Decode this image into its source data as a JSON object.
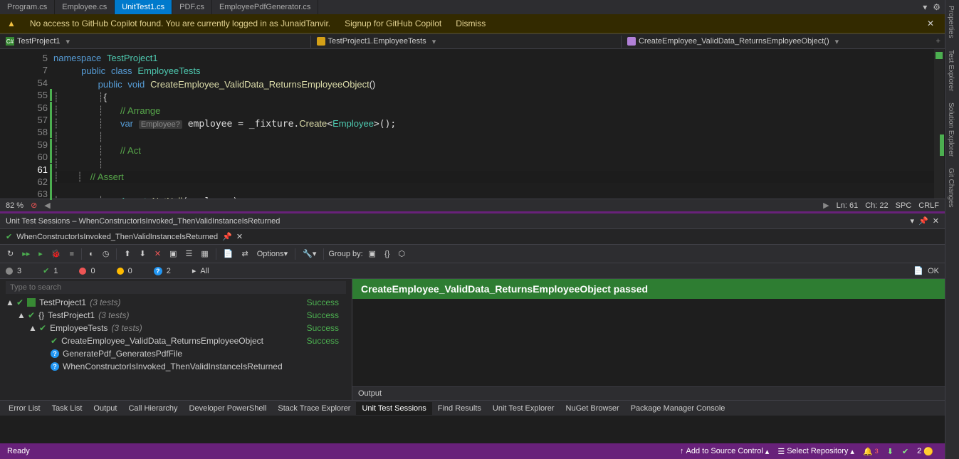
{
  "tabs": [
    "Program.cs",
    "Employee.cs",
    "UnitTest1.cs",
    "PDF.cs",
    "EmployeePdfGenerator.cs"
  ],
  "activeTab": 2,
  "notif": {
    "text": "No access to GitHub Copilot found. You are currently logged in as JunaidTanvir.",
    "signup": "Signup for GitHub Copilot",
    "dismiss": "Dismiss"
  },
  "nav": {
    "file": "TestProject1",
    "type": "TestProject1.EmployeeTests",
    "member": "CreateEmployee_ValidData_ReturnsEmployeeObject()"
  },
  "code": {
    "lines": [
      "5",
      "7",
      "54",
      "55",
      "56",
      "57",
      "58",
      "59",
      "60",
      "61",
      "62",
      "63"
    ],
    "curLine": 9
  },
  "estat": {
    "zoom": "82 %",
    "ln": "Ln: 61",
    "ch": "Ch: 22",
    "ind": "SPC",
    "enc": "CRLF"
  },
  "sess": {
    "title": "Unit Test Sessions – WhenConstructorIsInvoked_ThenValidInstanceIsReturned",
    "tab": "WhenConstructorIsInvoked_ThenValidInstanceIsReturned",
    "options": "Options",
    "groupby": "Group by:"
  },
  "stats": {
    "total": "3",
    "pass": "1",
    "fail": "0",
    "skip": "0",
    "inc": "2",
    "all": "All",
    "ok": "OK"
  },
  "search": {
    "ph": "Type to search"
  },
  "tree": [
    {
      "ind": 0,
      "exp": "▲",
      "ico": "chk",
      "name": "TestProject1",
      "dim": "(3 tests)",
      "stat": "Success",
      "proj": true
    },
    {
      "ind": 1,
      "exp": "▲",
      "ico": "chk",
      "name": "TestProject1",
      "dim": "(3 tests)",
      "stat": "Success",
      "ns": true
    },
    {
      "ind": 2,
      "exp": "▲",
      "ico": "chk",
      "name": "EmployeeTests",
      "dim": "(3 tests)",
      "stat": "Success"
    },
    {
      "ind": 3,
      "exp": "",
      "ico": "chk",
      "name": "CreateEmployee_ValidData_ReturnsEmployeeObject",
      "dim": "",
      "stat": "Success"
    },
    {
      "ind": 3,
      "exp": "",
      "ico": "qm",
      "name": "GeneratePdf_GeneratesPdfFile",
      "dim": "",
      "stat": ""
    },
    {
      "ind": 3,
      "exp": "",
      "ico": "qm",
      "name": "WhenConstructorIsInvoked_ThenValidInstanceIsReturned",
      "dim": "",
      "stat": ""
    }
  ],
  "banner": "CreateEmployee_ValidData_ReturnsEmployeeObject passed",
  "output": "Output",
  "bottabs": [
    "Error List",
    "Task List",
    "Output",
    "Call Hierarchy",
    "Developer PowerShell",
    "Stack Trace Explorer",
    "Unit Test Sessions",
    "Find Results",
    "Unit Test Explorer",
    "NuGet Browser",
    "Package Manager Console"
  ],
  "botactive": 6,
  "status": {
    "ready": "Ready",
    "src": "Add to Source Control",
    "repo": "Select Repository",
    "n": "2"
  },
  "side": [
    "Properties",
    "Test Explorer",
    "Solution Explorer",
    "Git Changes"
  ]
}
